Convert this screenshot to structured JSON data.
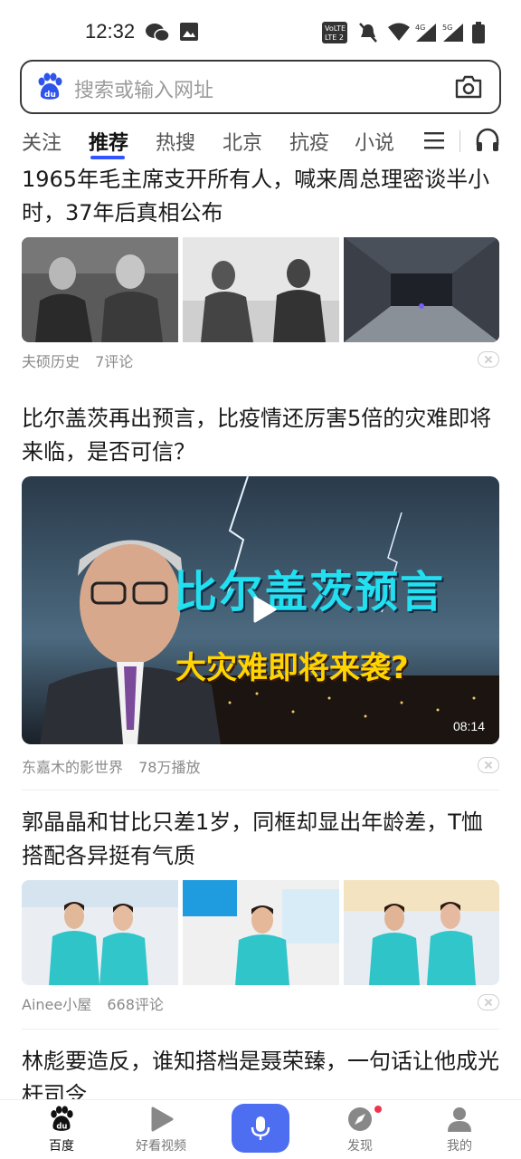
{
  "status_bar": {
    "time": "12:32",
    "network_labels": [
      "4G",
      "5G"
    ],
    "volte_label": "VoLTE 2"
  },
  "search": {
    "placeholder": "搜索或输入网址"
  },
  "tabs": [
    {
      "label": "关注",
      "active": false
    },
    {
      "label": "推荐",
      "active": true
    },
    {
      "label": "热搜",
      "active": false
    },
    {
      "label": "北京",
      "active": false
    },
    {
      "label": "抗疫",
      "active": false
    },
    {
      "label": "小说",
      "active": false
    }
  ],
  "feed": {
    "articles": [
      {
        "title": "1965年毛主席支开所有人，喊来周总理密谈半小时，37年后真相公布",
        "source": "夫硕历史",
        "stat": "7评论"
      },
      {
        "title": "比尔盖茨再出预言，比疫情还厉害5倍的灾难即将来临，是否可信？",
        "video_overlay_line1": "比尔盖茨预言",
        "video_overlay_line2": "大灾难即将来袭?",
        "duration": "08:14",
        "source": "东嘉木的影世界",
        "stat": "78万播放"
      },
      {
        "title": "郭晶晶和甘比只差1岁，同框却显出年龄差，T恤搭配各异挺有气质",
        "source": "Ainee小屋",
        "stat": "668评论"
      },
      {
        "title": "林彪要造反，谁知搭档是聂荣臻，一句话让他成光杆司令"
      }
    ]
  },
  "bottom_nav": [
    {
      "label": "百度",
      "icon": "baidu-paw-icon",
      "active": true
    },
    {
      "label": "好看视频",
      "icon": "play-video-icon",
      "active": false
    },
    {
      "label": "",
      "icon": "microphone-icon",
      "active": false
    },
    {
      "label": "发现",
      "icon": "compass-icon",
      "active": false
    },
    {
      "label": "我的",
      "icon": "user-icon",
      "active": false
    }
  ],
  "colors": {
    "accent": "#4e6ef2",
    "tab_underline": "#3355ff",
    "badge": "#f2334e"
  }
}
